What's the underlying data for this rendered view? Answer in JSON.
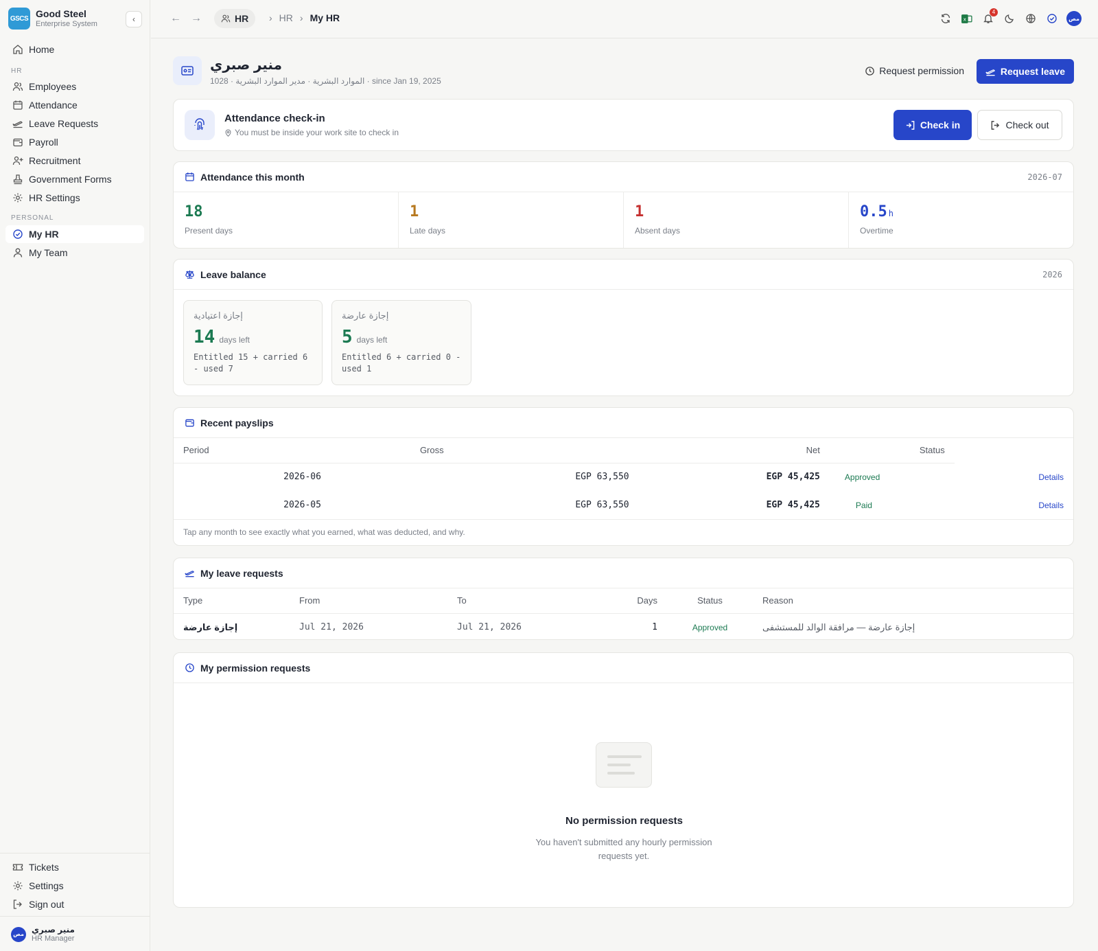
{
  "brand": {
    "logo": "GSCS",
    "name": "Good Steel",
    "subtitle": "Enterprise System"
  },
  "sidebar": {
    "home": "Home",
    "hr_section": "HR",
    "hr_items": [
      "Employees",
      "Attendance",
      "Leave Requests",
      "Payroll",
      "Recruitment",
      "Government Forms",
      "HR Settings"
    ],
    "personal_section": "PERSONAL",
    "personal_items": [
      "My HR",
      "My Team"
    ],
    "footer_items": [
      "Tickets",
      "Settings",
      "Sign out"
    ],
    "user": {
      "avatar": "مص",
      "name": "منير صبري",
      "role": "HR Manager"
    }
  },
  "topbar": {
    "module": "HR",
    "crumbs": [
      "HR",
      "My HR"
    ],
    "notifications_count": "4",
    "avatar": "مص"
  },
  "employee": {
    "name": "منير صبري",
    "meta": "الموارد البشرية · مدير الموارد البشرية · 1028 · since Jan 19, 2025",
    "request_permission": "Request permission",
    "request_leave": "Request leave"
  },
  "checkin": {
    "title": "Attendance check-in",
    "subtitle": "You must be inside your work site to check in",
    "check_in": "Check in",
    "check_out": "Check out"
  },
  "attendance": {
    "title": "Attendance this month",
    "period": "2026-07",
    "stats": [
      {
        "value": "18",
        "label": "Present days",
        "color": "#1c7a52"
      },
      {
        "value": "1",
        "label": "Late days",
        "color": "#b7791f"
      },
      {
        "value": "1",
        "label": "Absent days",
        "color": "#c53030"
      },
      {
        "value": "0.5",
        "unit": "h",
        "label": "Overtime",
        "color": "#2746c9"
      }
    ]
  },
  "leave_balance": {
    "title": "Leave balance",
    "year": "2026",
    "items": [
      {
        "type": "إجازة اعتيادية",
        "left": "14",
        "left_label": "days left",
        "detail": "Entitled 15 + carried 6 - used 7"
      },
      {
        "type": "إجازة عارضة",
        "left": "5",
        "left_label": "days left",
        "detail": "Entitled 6 + carried 0 - used 1"
      }
    ]
  },
  "payslips": {
    "title": "Recent payslips",
    "columns": [
      "Period",
      "Gross",
      "Net",
      "Status"
    ],
    "rows": [
      {
        "period": "2026-06",
        "gross": "EGP 63,550",
        "net": "EGP 45,425",
        "status": "Approved",
        "action": "Details"
      },
      {
        "period": "2026-05",
        "gross": "EGP 63,550",
        "net": "EGP 45,425",
        "status": "Paid",
        "action": "Details"
      }
    ],
    "note": "Tap any month to see exactly what you earned, what was deducted, and why."
  },
  "leave_requests": {
    "title": "My leave requests",
    "columns": [
      "Type",
      "From",
      "To",
      "Days",
      "Status",
      "Reason"
    ],
    "rows": [
      {
        "type": "إجازة عارضة",
        "from": "Jul 21, 2026",
        "to": "Jul 21, 2026",
        "days": "1",
        "status": "Approved",
        "reason": "إجازة عارضة — مرافقة الوالد للمستشفى"
      }
    ]
  },
  "permission_requests": {
    "title": "My permission requests",
    "empty_title": "No permission requests",
    "empty_sub": "You haven't submitted any hourly permission requests yet."
  }
}
